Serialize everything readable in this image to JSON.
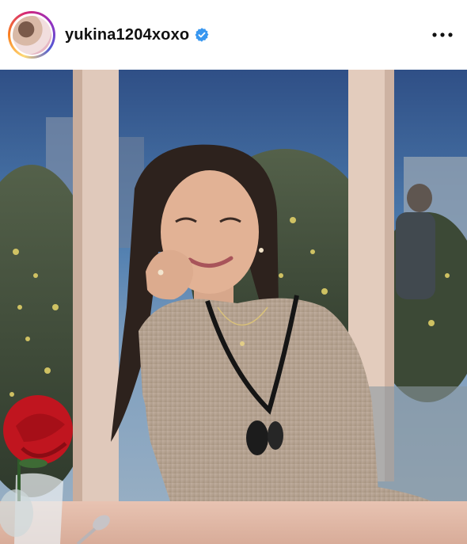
{
  "post": {
    "username": "yukina1204xoxo",
    "verified": true
  },
  "icons": {
    "avatar": "profile-avatar",
    "verified": "verified-badge-icon",
    "more": "more-options-icon"
  },
  "colors": {
    "verified_blue": "#3897f0",
    "text": "#111111"
  }
}
